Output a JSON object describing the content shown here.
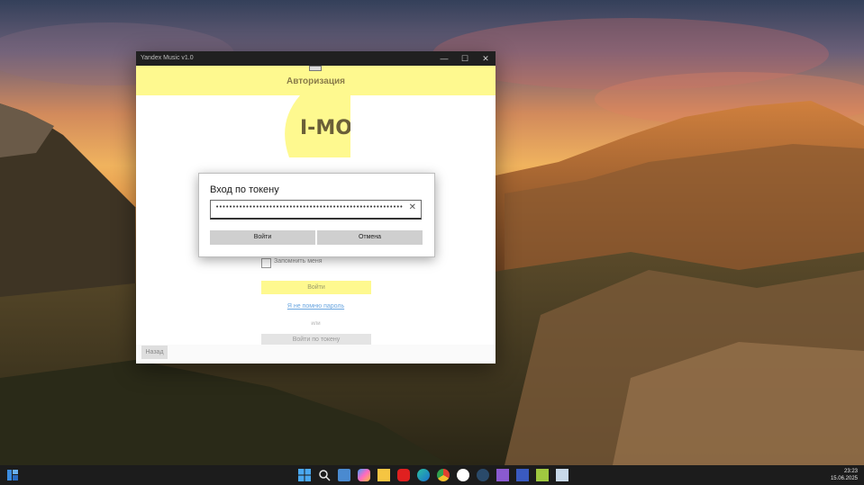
{
  "window": {
    "title": "Yandex Music v1.0",
    "controls": {
      "minimize": "—",
      "maximize": "☐",
      "close": "✕"
    }
  },
  "auth": {
    "header_title": "Авторизация",
    "logo_text": "I-MO",
    "remember_label": "Запомнить меня",
    "login_button": "Войти",
    "forgot_link": "Я не помню пароль",
    "or_text": "или",
    "token_login_button": "Войти по токену",
    "back_button": "Назад"
  },
  "token_dialog": {
    "title": "Вход по токену",
    "token_value": "••••••••••••••••••••••••••••••••••••••••••••••••••••••••••",
    "clear_icon": "✕",
    "ok_button": "Войти",
    "cancel_button": "Отмена"
  },
  "taskbar": {
    "time": "23:23",
    "date": "15.06.2025",
    "icons": [
      "widgets-icon",
      "start-icon",
      "search-icon",
      "taskview-icon",
      "copilot-icon",
      "explorer-icon",
      "youtube-icon",
      "edge-icon",
      "chrome-icon",
      "yandex-icon",
      "steam-icon",
      "visualstudio-icon",
      "save-icon",
      "sticky-icon",
      "app-icon"
    ]
  },
  "colors": {
    "accent_yellow": "#fef98f",
    "titlebar": "#202020",
    "taskbar": "#1c1c1c"
  }
}
